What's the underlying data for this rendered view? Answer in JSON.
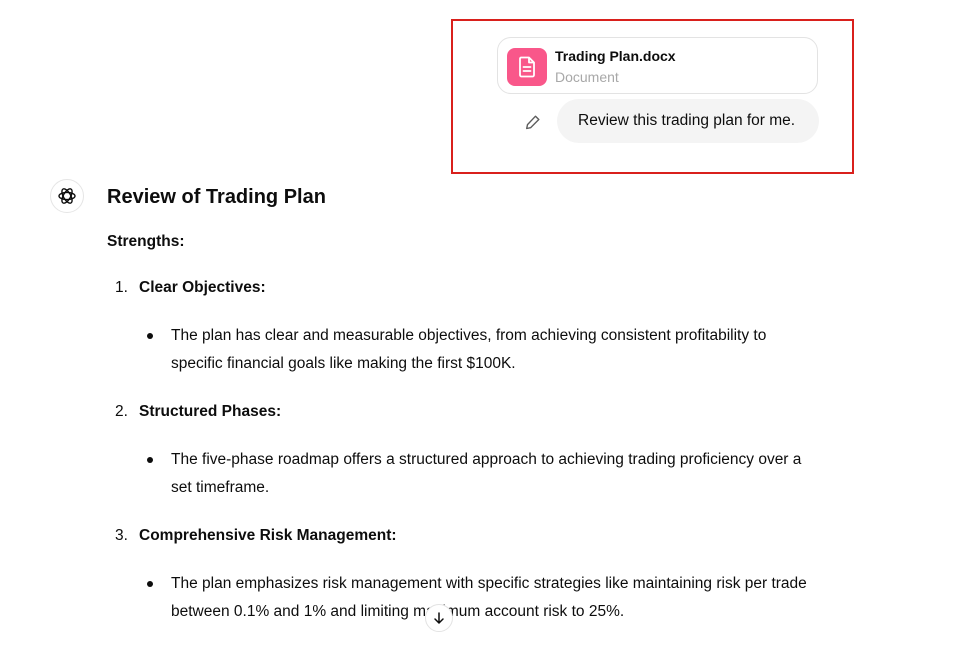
{
  "attachment": {
    "file_name": "Trading Plan.docx",
    "file_type": "Document",
    "icon": "document-icon",
    "icon_color": "#f9578a"
  },
  "user_message": {
    "text": "Review this trading plan for me."
  },
  "assistant": {
    "title": "Review of Trading Plan",
    "section_label": "Strengths:",
    "items": [
      {
        "number": "1.",
        "heading": "Clear Objectives:",
        "bullet": "The plan has clear and measurable objectives, from achieving consistent profitability to specific financial goals like making the first $100K."
      },
      {
        "number": "2.",
        "heading": "Structured Phases:",
        "bullet": "The five-phase roadmap offers a structured approach to achieving trading proficiency over a set timeframe."
      },
      {
        "number": "3.",
        "heading": "Comprehensive Risk Management:",
        "bullet": "The plan emphasizes risk management with specific strategies like maintaining risk per trade between 0.1% and 1% and limiting maximum account risk to 25%."
      }
    ]
  },
  "colors": {
    "highlight_border": "#d9201c",
    "bubble_bg": "#f4f4f4"
  }
}
